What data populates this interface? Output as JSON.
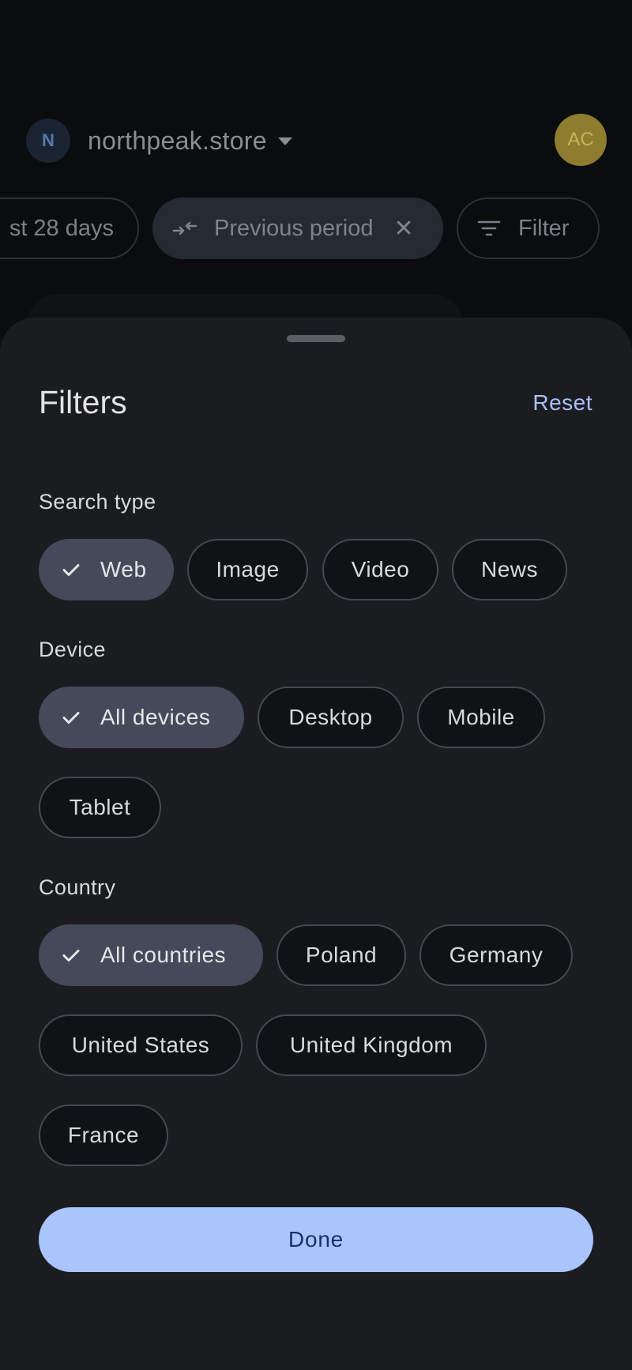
{
  "background": {
    "site": {
      "avatar_letter": "N",
      "name": "northpeak.store"
    },
    "account_avatar": "AC",
    "chips": {
      "date_range": "st 28 days",
      "comparison": "Previous period",
      "filter": "Filter"
    }
  },
  "sheet": {
    "title": "Filters",
    "reset_label": "Reset",
    "sections": {
      "search_type": {
        "label": "Search type",
        "options": [
          "Web",
          "Image",
          "Video",
          "News"
        ],
        "selected": "Web"
      },
      "device": {
        "label": "Device",
        "options": [
          "All devices",
          "Desktop",
          "Mobile",
          "Tablet"
        ],
        "selected": "All devices"
      },
      "country": {
        "label": "Country",
        "options": [
          "All countries",
          "Poland",
          "Germany",
          "United States",
          "United Kingdom",
          "France"
        ],
        "selected": "All countries"
      }
    },
    "done_label": "Done"
  },
  "icons": {
    "check": "check-icon",
    "caret": "dropdown-caret-icon",
    "compare": "compare-arrows-icon",
    "close": "close-icon",
    "filter": "filter-list-icon"
  },
  "colors": {
    "sheet_bg": "#1b1c1f",
    "selected_chip": "#45495a",
    "accent": "#a9c0f8",
    "done_button": "#a9c5fc"
  }
}
